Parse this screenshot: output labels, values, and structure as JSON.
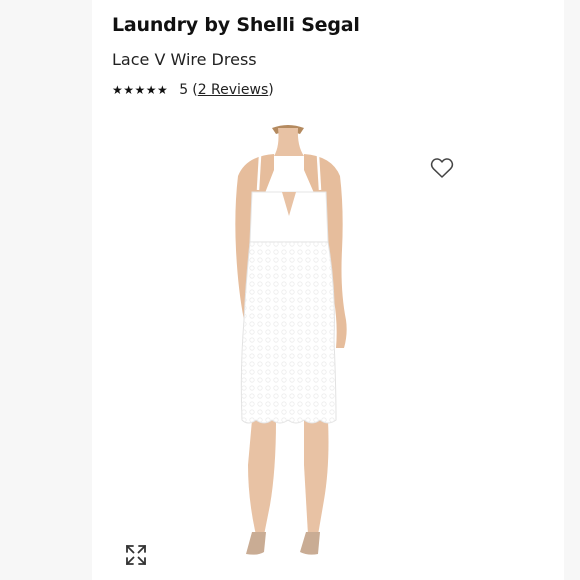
{
  "product": {
    "brand": "Laundry by Shelli Segal",
    "name": "Lace V Wire Dress",
    "rating": {
      "stars": "★★★★★",
      "score": "5",
      "reviews_open": "(",
      "reviews_label": "2 Reviews",
      "reviews_close": ")",
      "value": 5,
      "max": 5
    }
  },
  "icons": {
    "favorite": "heart-outline-icon",
    "expand": "expand-arrows-icon"
  },
  "colors": {
    "dress": "#ffffff",
    "text": "#111111",
    "page_background": "#f7f7f7"
  }
}
